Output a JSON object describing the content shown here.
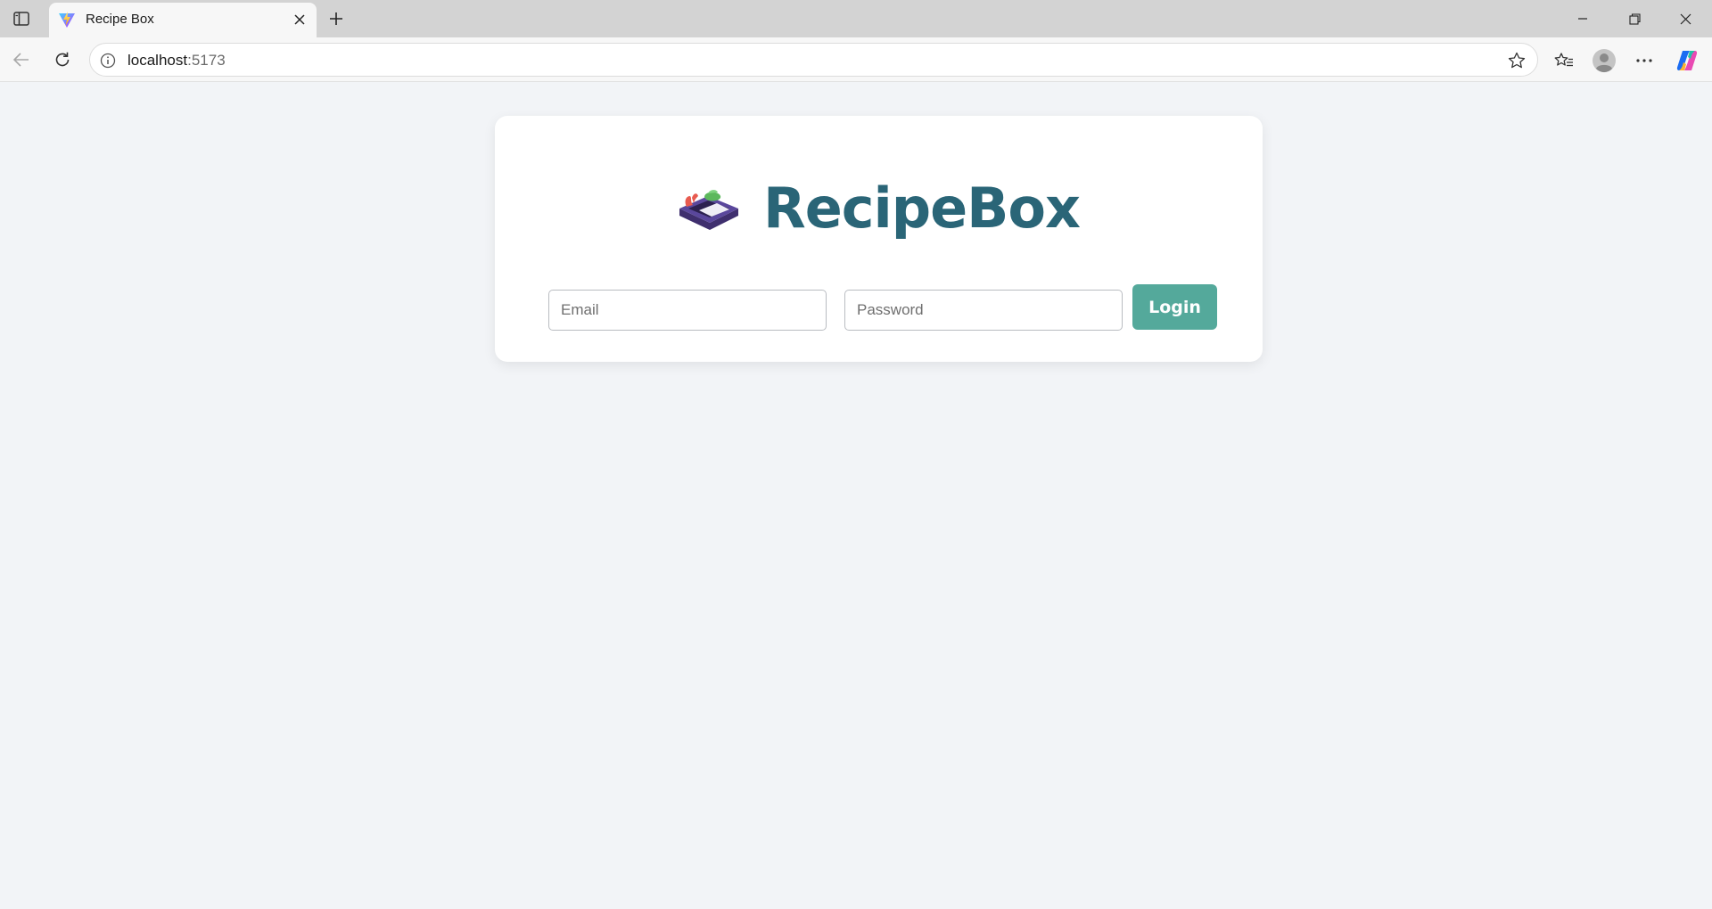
{
  "browser": {
    "tab": {
      "title": "Recipe Box",
      "favicon": "vite-logo-icon"
    },
    "address": {
      "host": "localhost",
      "port": ":5173"
    },
    "icons": {
      "sidebar": "sidebar-toggle-icon",
      "close_tab": "close-icon",
      "new_tab": "plus-icon",
      "minimize": "minimize-icon",
      "restore": "restore-icon",
      "close_window": "close-window-icon",
      "back": "back-arrow-icon",
      "refresh": "refresh-icon",
      "site_info": "info-icon",
      "favorite": "star-icon",
      "favorites": "favorites-icon",
      "profile": "profile-icon",
      "menu": "more-icon",
      "copilot": "copilot-icon"
    }
  },
  "page": {
    "brand": {
      "name": "RecipeBox",
      "logo": "recipe-box-icon"
    },
    "form": {
      "email_placeholder": "Email",
      "password_placeholder": "Password",
      "login_label": "Login"
    }
  },
  "colors": {
    "brand": "#2a6577",
    "button": "#54a99b",
    "background": "#f2f4f7"
  }
}
